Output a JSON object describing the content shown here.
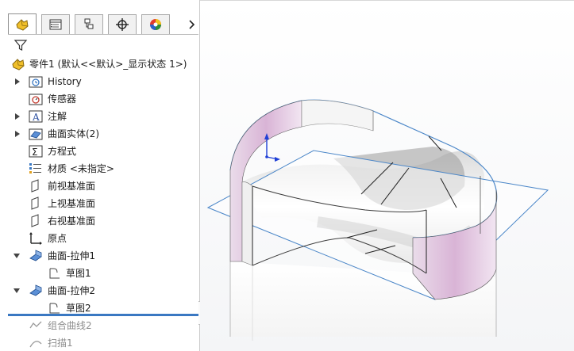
{
  "tabs": [
    {
      "name": "featuremanager",
      "icon": "featuremanager-icon"
    },
    {
      "name": "propertymanager",
      "icon": "propertymanager-icon"
    },
    {
      "name": "configurationmanager",
      "icon": "configurationmanager-icon"
    },
    {
      "name": "dimxpertmanager",
      "icon": "dimxpertmanager-icon"
    },
    {
      "name": "displaymanager",
      "icon": "displaymanager-icon"
    }
  ],
  "tree": {
    "root": "零件1 (默认<<默认>_显示状态 1>)",
    "items": [
      {
        "label": "History"
      },
      {
        "label": "传感器"
      },
      {
        "label": "注解"
      },
      {
        "label": "曲面实体(2)"
      },
      {
        "label": "方程式"
      },
      {
        "label": "材质 <未指定>"
      },
      {
        "label": "前视基准面"
      },
      {
        "label": "上视基准面"
      },
      {
        "label": "右视基准面"
      },
      {
        "label": "原点"
      },
      {
        "label": "曲面-拉伸1"
      },
      {
        "label": "草图1"
      },
      {
        "label": "曲面-拉伸2"
      },
      {
        "label": "草图2"
      },
      {
        "label": "组合曲线2"
      },
      {
        "label": "扫描1"
      }
    ]
  },
  "colors": {
    "accent": "#3a78c2",
    "part_yellow": "#e8b21a",
    "surface_pink": "#d9b4d6"
  }
}
